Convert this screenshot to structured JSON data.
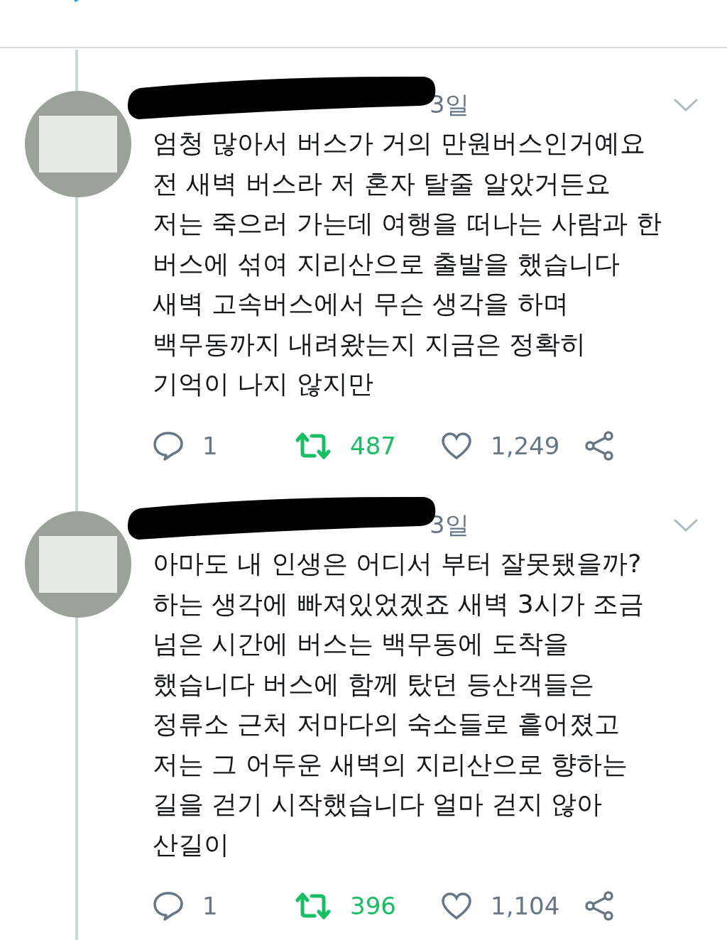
{
  "tweets": [
    {
      "time": "3일",
      "text": "엄청 많아서 버스가 거의 만원버스인거예요\n전 새벽 버스라 저 혼자 탈줄 알았거든요\n저는 죽으러 가는데 여행을 떠나는 사람과 한\n버스에 섞여 지리산으로 출발을 했습니다\n새벽 고속버스에서 무슨 생각을 하며\n백무동까지 내려왔는지 지금은 정확히\n기억이 나지 않지만",
      "replies": "1",
      "retweets": "487",
      "retweeted": true,
      "likes": "1,249",
      "liked": false
    },
    {
      "time": "3일",
      "text": "아마도 내 인생은 어디서 부터 잘못됐을까?\n하는 생각에 빠져있었겠죠 새벽 3시가 조금\n넘은 시간에 버스는 백무동에 도착을\n했습니다 버스에 함께 탔던 등산객들은\n정류소 근처 저마다의 숙소들로 흩어졌고\n저는 그 어두운 새벽의 지리산으로 향하는\n길을 걷기 시작했습니다 얼마 걷지 않아\n산길이",
      "replies": "1",
      "retweets": "396",
      "retweeted": true,
      "likes": "1,104",
      "liked": false
    }
  ]
}
